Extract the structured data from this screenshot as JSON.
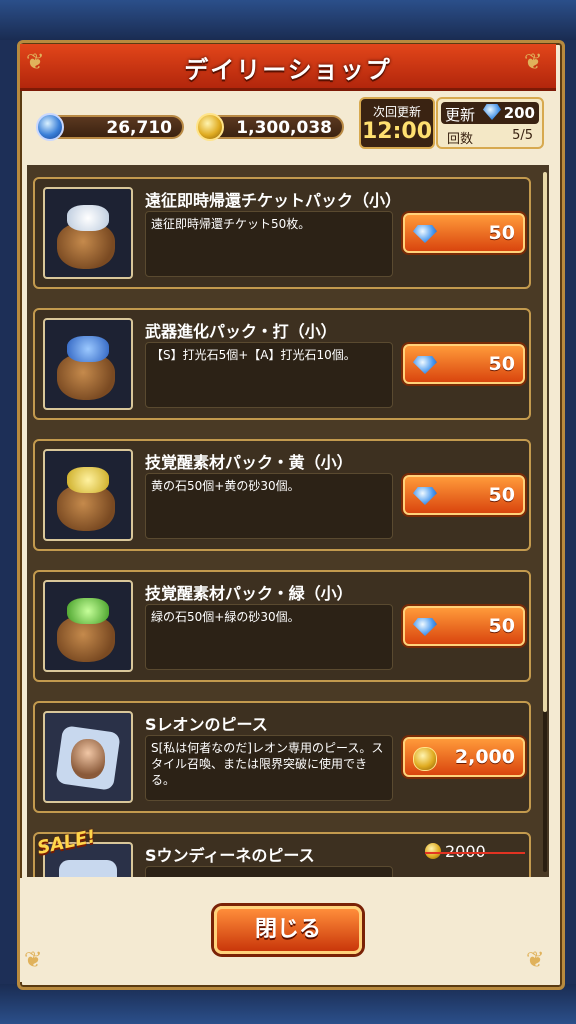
{
  "header": {
    "title": "デイリーショップ"
  },
  "currency": {
    "gems": "26,710",
    "gold": "1,300,038"
  },
  "timer": {
    "label": "次回更新",
    "time": "12:00"
  },
  "refresh": {
    "label": "更新",
    "cost": "200",
    "count_label": "回数",
    "count": "5/5"
  },
  "items": [
    {
      "name": "遠征即時帰還チケットパック（小）",
      "description": "遠征即時帰還チケット50枚。",
      "price": "50",
      "currency": "gem",
      "icon": "ticket-bag-icon",
      "accent": "#e8eef5"
    },
    {
      "name": "武器進化パック・打（小）",
      "description": "【S】打光石5個+【A】打光石10個。",
      "price": "50",
      "currency": "gem",
      "icon": "blue-stone-bag-icon",
      "accent": "#3b78d8"
    },
    {
      "name": "技覚醒素材パック・黄（小）",
      "description": "黄の石50個+黄の砂30個。",
      "price": "50",
      "currency": "gem",
      "icon": "yellow-stone-bag-icon",
      "accent": "#d9c23a"
    },
    {
      "name": "技覚醒素材パック・緑（小）",
      "description": "緑の石50個+緑の砂30個。",
      "price": "50",
      "currency": "gem",
      "icon": "green-stone-bag-icon",
      "accent": "#5fbf3a"
    },
    {
      "name": "Sレオンのピース",
      "description": "S[私は何者なのだ]レオン専用のピース。スタイル召喚、または限界突破に使用できる。",
      "price": "2,000",
      "currency": "gold",
      "icon": "leon-piece-icon",
      "accent": "#c8d8ee"
    },
    {
      "name": "Sウンディーネのピース",
      "description": "",
      "price": "",
      "old_price": "2000",
      "sale": "SALE!",
      "currency": "gold",
      "icon": "undine-piece-icon",
      "accent": "#c8d8ee"
    }
  ],
  "footer": {
    "close_label": "閉じる"
  }
}
